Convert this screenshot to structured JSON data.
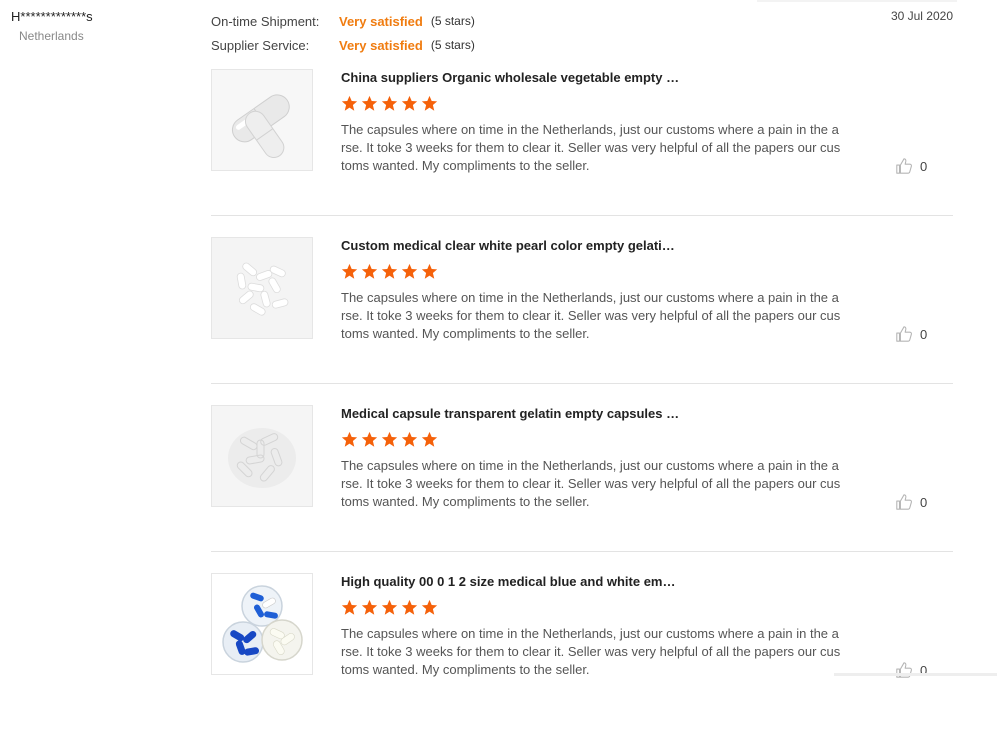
{
  "buyer": {
    "name": "H*************s",
    "country": "Netherlands"
  },
  "ratings": [
    {
      "label": "On-time Shipment:",
      "value": "Very satisfied",
      "stars": "(5 stars)"
    },
    {
      "label": "Supplier Service:",
      "value": "Very satisfied",
      "stars": "(5 stars)"
    }
  ],
  "date": "30 Jul 2020",
  "colors": {
    "accent": "#f07c10",
    "star": "#f5610a",
    "divider": "#e3e3e3"
  },
  "reviews": [
    {
      "title": "China suppliers Organic wholesale vegetable empty c...",
      "rating": 5,
      "text": "The capsules where on time in the Netherlands, just our customs where a pain in the arse. It toke 3 weeks for them to clear it. Seller was very helpful of all the papers our customs wanted. My compliments to the seller.",
      "likes": "0",
      "image": "clear-capsules"
    },
    {
      "title": "Custom medical clear white pearl color empty gelatin ...",
      "rating": 5,
      "text": "The capsules where on time in the Netherlands, just our customs where a pain in the arse. It toke 3 weeks for them to clear it. Seller was very helpful of all the papers our customs wanted. My compliments to the seller.",
      "likes": "0",
      "image": "white-capsules"
    },
    {
      "title": "Medical capsule transparent gelatin empty capsules s...",
      "rating": 5,
      "text": "The capsules where on time in the Netherlands, just our customs where a pain in the arse. It toke 3 weeks for them to clear it. Seller was very helpful of all the papers our customs wanted. My compliments to the seller.",
      "likes": "0",
      "image": "transparent-capsule-pile"
    },
    {
      "title": "High quality 00 0 1 2 size medical blue and white emp...",
      "rating": 5,
      "text": "The capsules where on time in the Netherlands, just our customs where a pain in the arse. It toke 3 weeks for them to clear it. Seller was very helpful of all the papers our customs wanted. My compliments to the seller.",
      "likes": "0",
      "image": "blue-white-capsule-dishes"
    }
  ]
}
